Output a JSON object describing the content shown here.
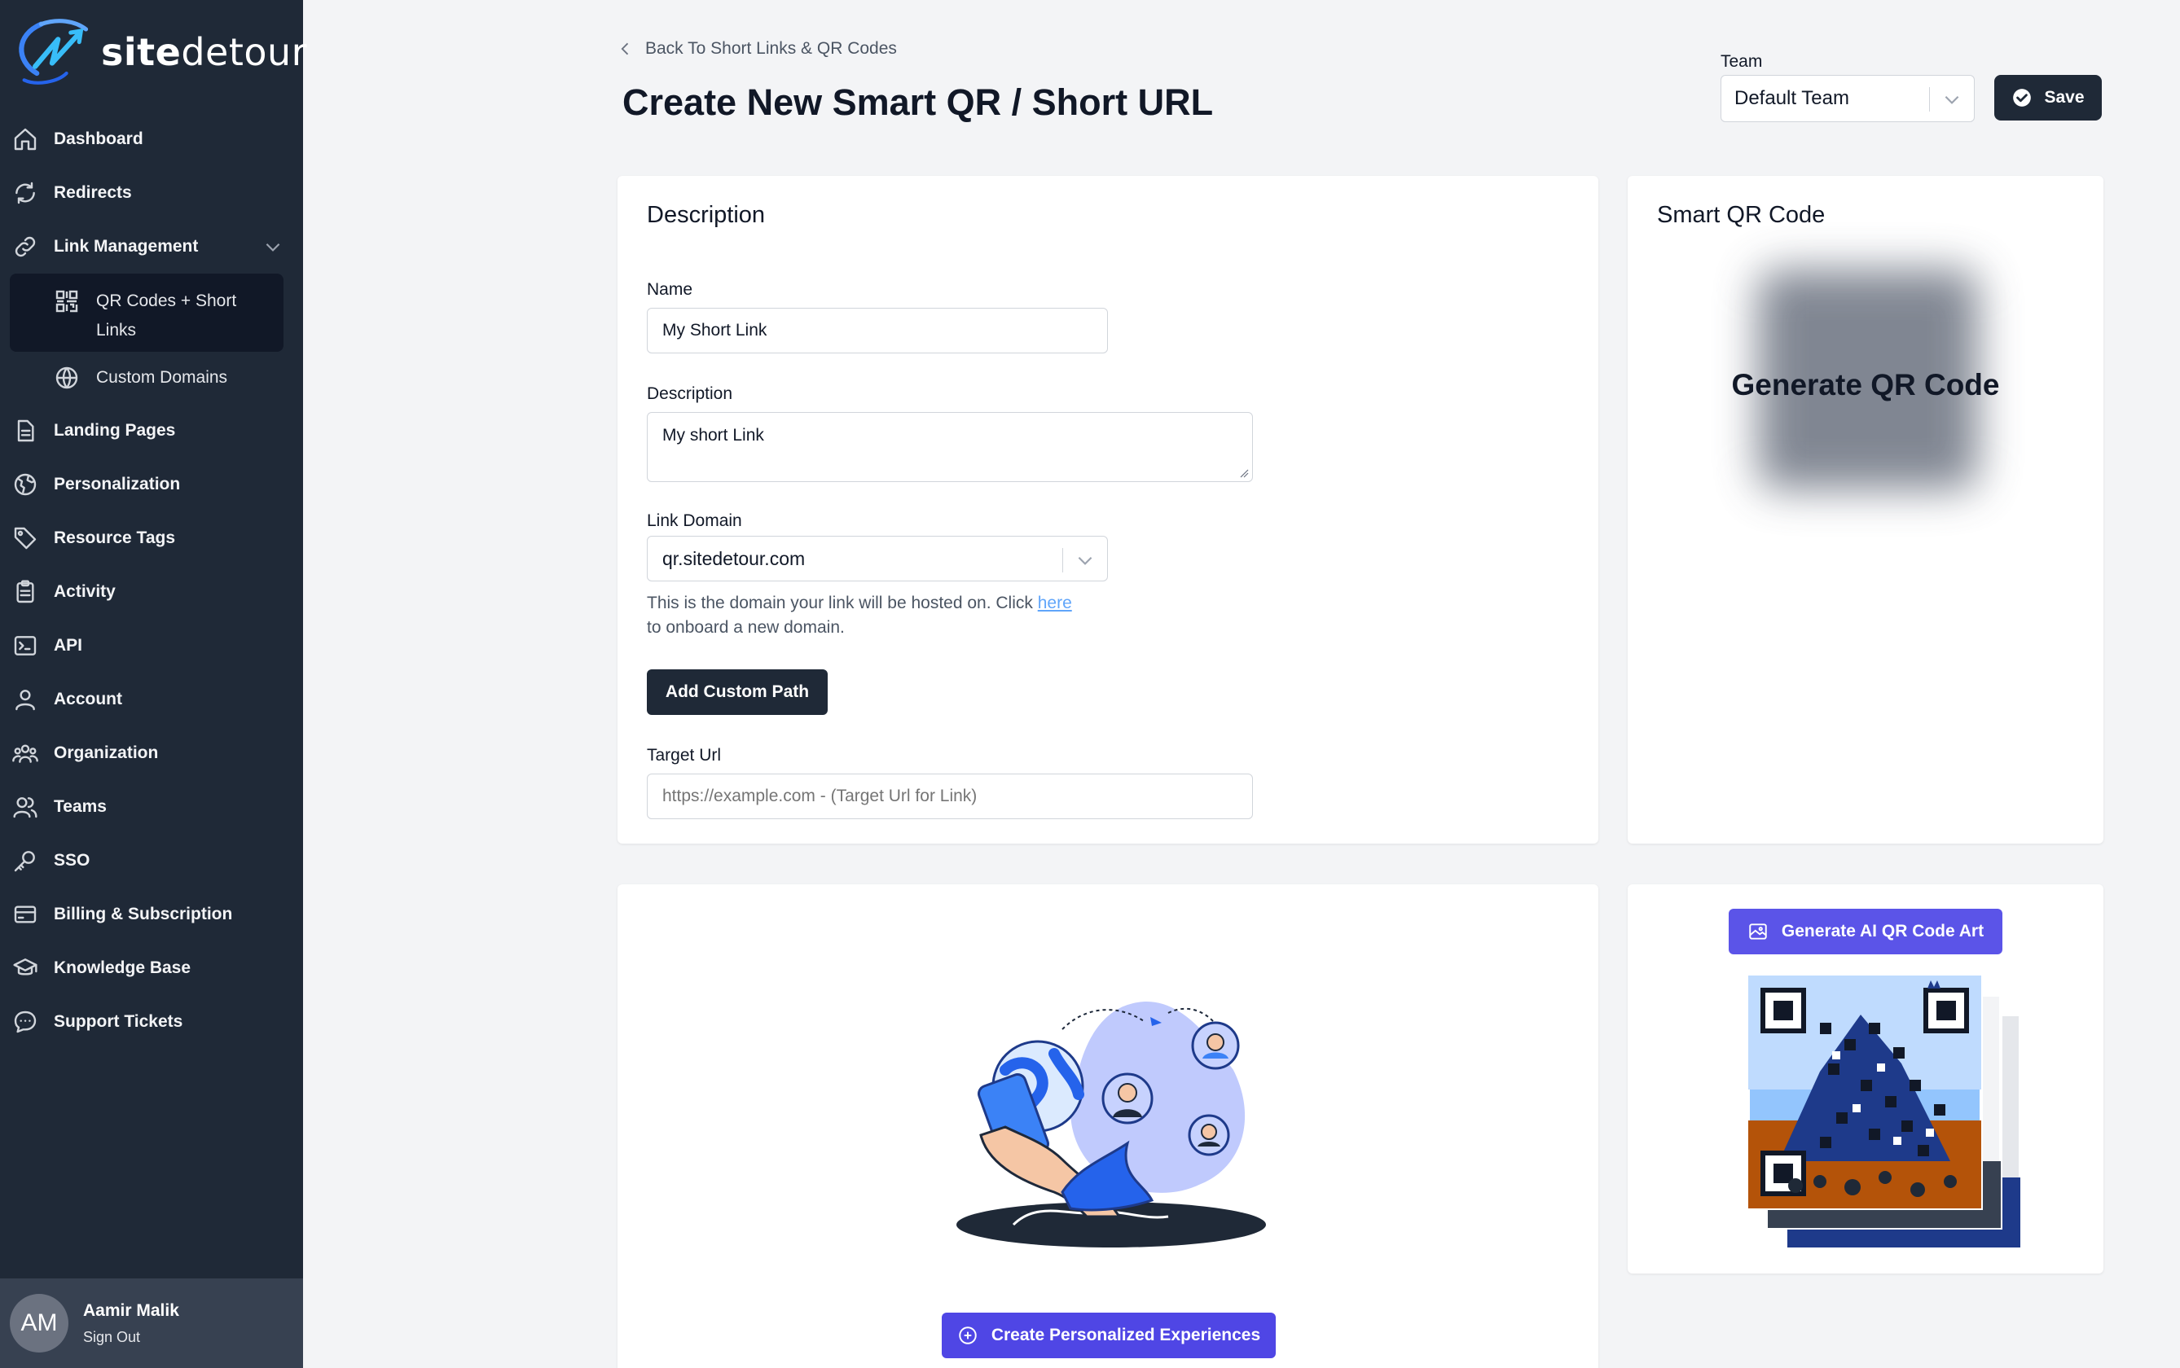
{
  "brand": {
    "name_prefix": "site",
    "name_suffix": "detour"
  },
  "sidebar": {
    "items": [
      {
        "label": "Dashboard"
      },
      {
        "label": "Redirects"
      },
      {
        "label": "Link Management"
      },
      {
        "label": "QR Codes + Short Links"
      },
      {
        "label": "Custom Domains"
      },
      {
        "label": "Landing Pages"
      },
      {
        "label": "Personalization"
      },
      {
        "label": "Resource Tags"
      },
      {
        "label": "Activity"
      },
      {
        "label": "API"
      },
      {
        "label": "Account"
      },
      {
        "label": "Organization"
      },
      {
        "label": "Teams"
      },
      {
        "label": "SSO"
      },
      {
        "label": "Billing & Subscription"
      },
      {
        "label": "Knowledge Base"
      },
      {
        "label": "Support Tickets"
      }
    ],
    "user": {
      "initials": "AM",
      "name": "Aamir Malik",
      "signout": "Sign Out"
    }
  },
  "header": {
    "back_link": "Back To Short Links & QR Codes",
    "title": "Create New Smart QR / Short URL",
    "team_label": "Team",
    "team_value": "Default Team",
    "save_label": "Save"
  },
  "description_card": {
    "title": "Description",
    "name_label": "Name",
    "name_value": "My Short Link",
    "description_label": "Description",
    "description_value": "My short Link",
    "domain_label": "Link Domain",
    "domain_value": "qr.sitedetour.com",
    "domain_help_before": "This is the domain your link will be hosted on. Click ",
    "domain_help_link": "here",
    "domain_help_after": " to onboard a new domain.",
    "add_path_label": "Add Custom Path",
    "target_label": "Target Url",
    "target_placeholder": "https://example.com - (Target Url for Link)"
  },
  "qr_card": {
    "title": "Smart QR Code",
    "generate_label": "Generate QR Code"
  },
  "personalize_card": {
    "button_label": "Create Personalized Experiences"
  },
  "art_card": {
    "button_label": "Generate AI QR Code Art"
  },
  "colors": {
    "sidebar_bg": "#1f2937",
    "accent_purple": "#4f46e5",
    "dark_button": "#1f2937",
    "link_blue": "#60a5fa"
  }
}
